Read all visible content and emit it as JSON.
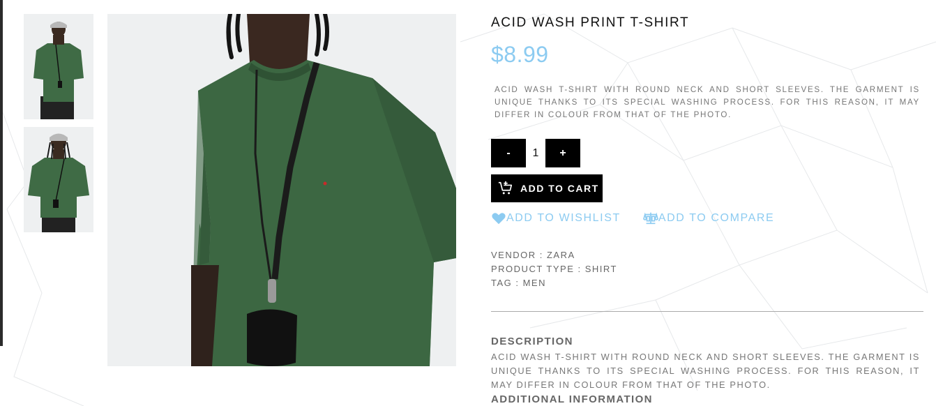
{
  "gallery": {
    "thumbnails": [
      {
        "alt": "thumbnail-1"
      },
      {
        "alt": "thumbnail-2"
      }
    ]
  },
  "product": {
    "title": "ACID WASH PRINT T-SHIRT",
    "price": "$8.99",
    "short_description": "ACID WASH T-SHIRT WITH ROUND NECK AND SHORT SLEEVES. THE GARMENT IS UNIQUE THANKS TO ITS SPECIAL WASHING PROCESS. FOR THIS REASON, IT MAY DIFFER IN COLOUR FROM THAT OF THE PHOTO.",
    "quantity": {
      "minus_label": "-",
      "value": "1",
      "plus_label": "+"
    },
    "add_to_cart_label": "ADD TO CART",
    "wishlist_label": "ADD TO WISHLIST",
    "compare_label": "ADD TO COMPARE",
    "meta": {
      "vendor": "VENDOR : ZARA",
      "product_type": "PRODUCT TYPE : SHIRT",
      "tag": "TAG : MEN"
    }
  },
  "tabs": {
    "description_heading": "DESCRIPTION",
    "description_body": "ACID WASH T-SHIRT WITH ROUND NECK AND SHORT SLEEVES. THE GARMENT IS UNIQUE THANKS TO ITS SPECIAL WASHING PROCESS. FOR THIS REASON, IT MAY DIFFER IN COLOUR FROM THAT OF THE PHOTO.",
    "additional_heading": "ADDITIONAL INFORMATION"
  },
  "icons": {
    "cart": "cart-plus-icon",
    "wishlist": "heart-icon",
    "compare": "scale-icon"
  },
  "colors": {
    "accent": "#8ccbf1",
    "button": "#000000",
    "shirt": "#3f6b45",
    "text_muted": "#777777"
  }
}
